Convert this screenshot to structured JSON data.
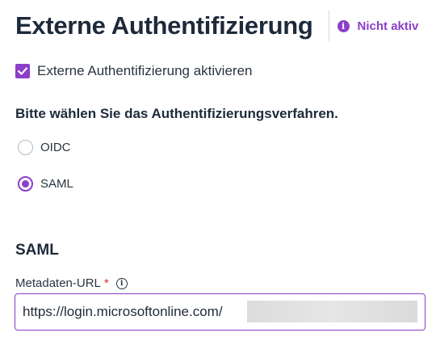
{
  "header": {
    "title": "Externe Authentifizierung",
    "status_label": "Nicht aktiv",
    "status_icon": "info-filled-icon",
    "accent_color": "#8a3ec9"
  },
  "external_auth": {
    "checkbox_label": "Externe Authentifizierung aktivieren",
    "checked": true
  },
  "method": {
    "question": "Bitte wählen Sie das Authentifizierungsverfahren.",
    "options": [
      {
        "label": "OIDC",
        "selected": false
      },
      {
        "label": "SAML",
        "selected": true
      }
    ]
  },
  "saml": {
    "section_title": "SAML",
    "metadata_url": {
      "label": "Metadaten-URL",
      "required_marker": "*",
      "info_icon": "info-outline-icon",
      "value": "https://login.microsoftonline.com/"
    }
  }
}
